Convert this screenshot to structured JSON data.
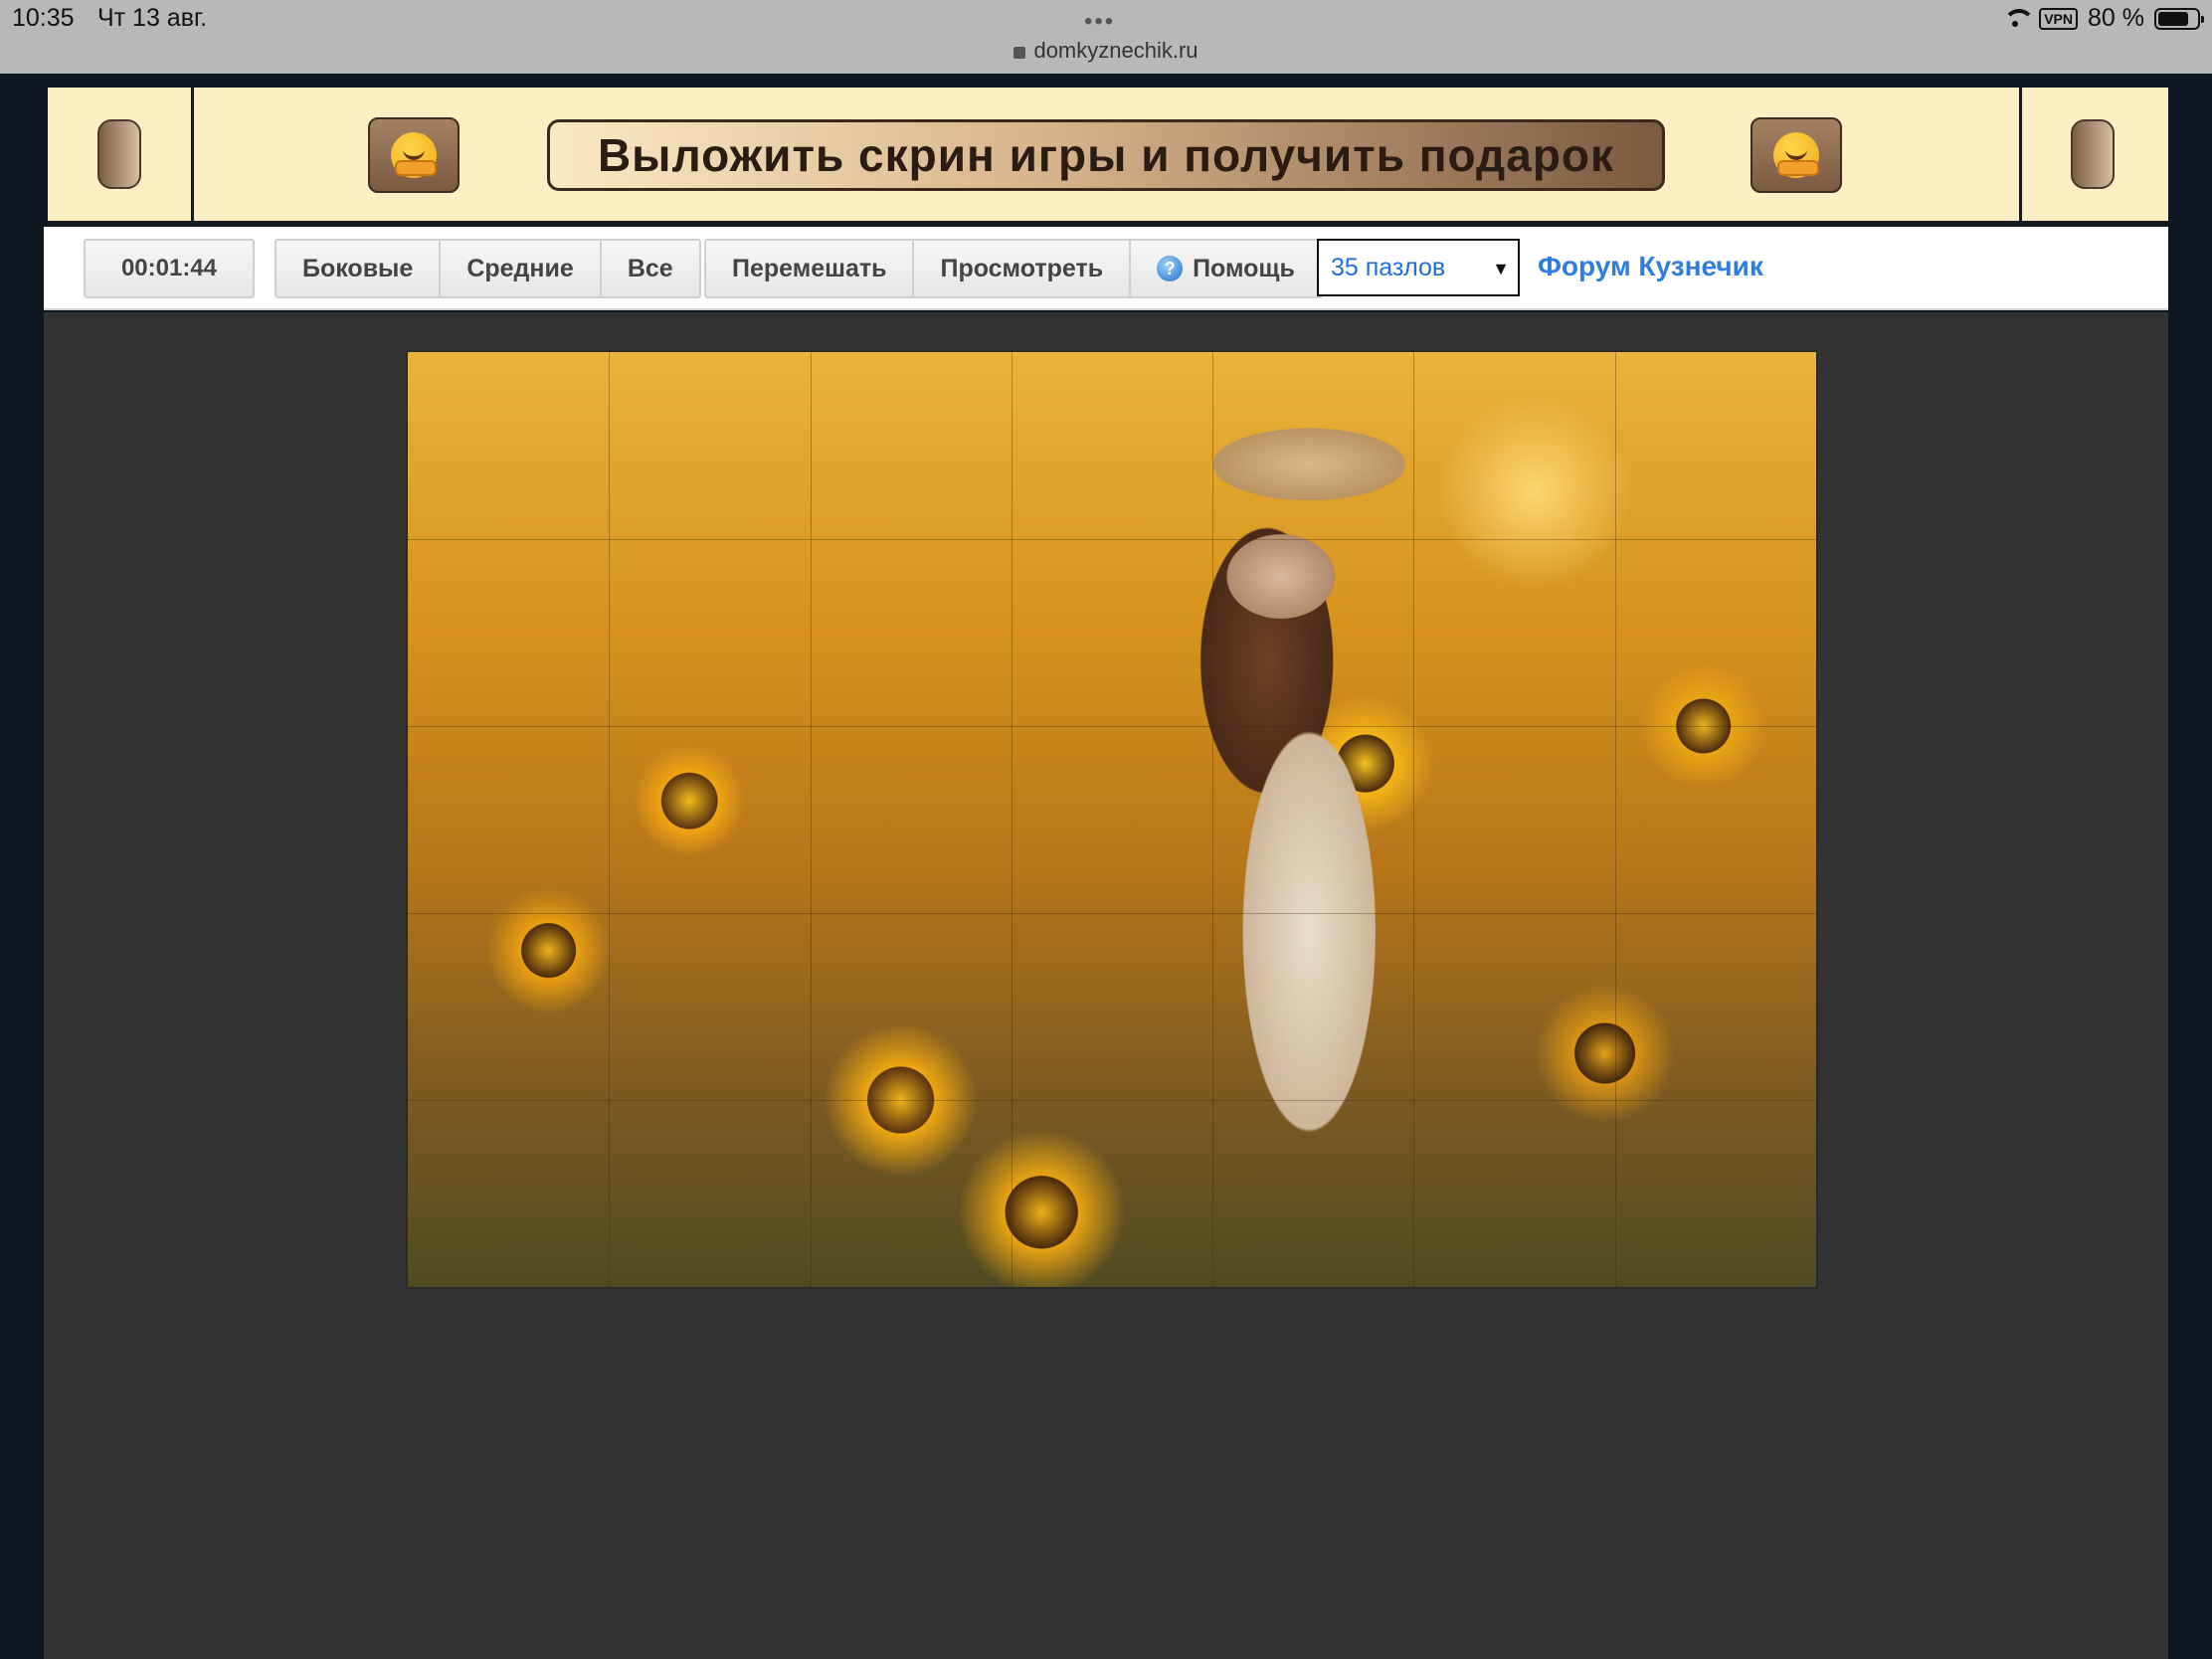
{
  "status_bar": {
    "time": "10:35",
    "date": "Чт 13 авг.",
    "url": "domkyznechik.ru",
    "vpn": "VPN",
    "battery": "80 %"
  },
  "banner": {
    "promo_text": "Выложить скрин игры и получить подарок"
  },
  "toolbar": {
    "timer": "00:01:44",
    "filter_buttons": [
      "Боковые",
      "Средние",
      "Все"
    ],
    "action_buttons": [
      "Перемешать",
      "Просмотреть",
      "Помощь"
    ],
    "pieces_select": "35 пазлов",
    "forum_link": "Форум Кузнечик"
  },
  "puzzle": {
    "columns": 7,
    "rows": 5,
    "pieces": 35
  },
  "colors": {
    "banner_bg": "#fdeec3",
    "stage_bg": "#333333",
    "link": "#2f7de1",
    "select_text": "#1e6fd9"
  }
}
